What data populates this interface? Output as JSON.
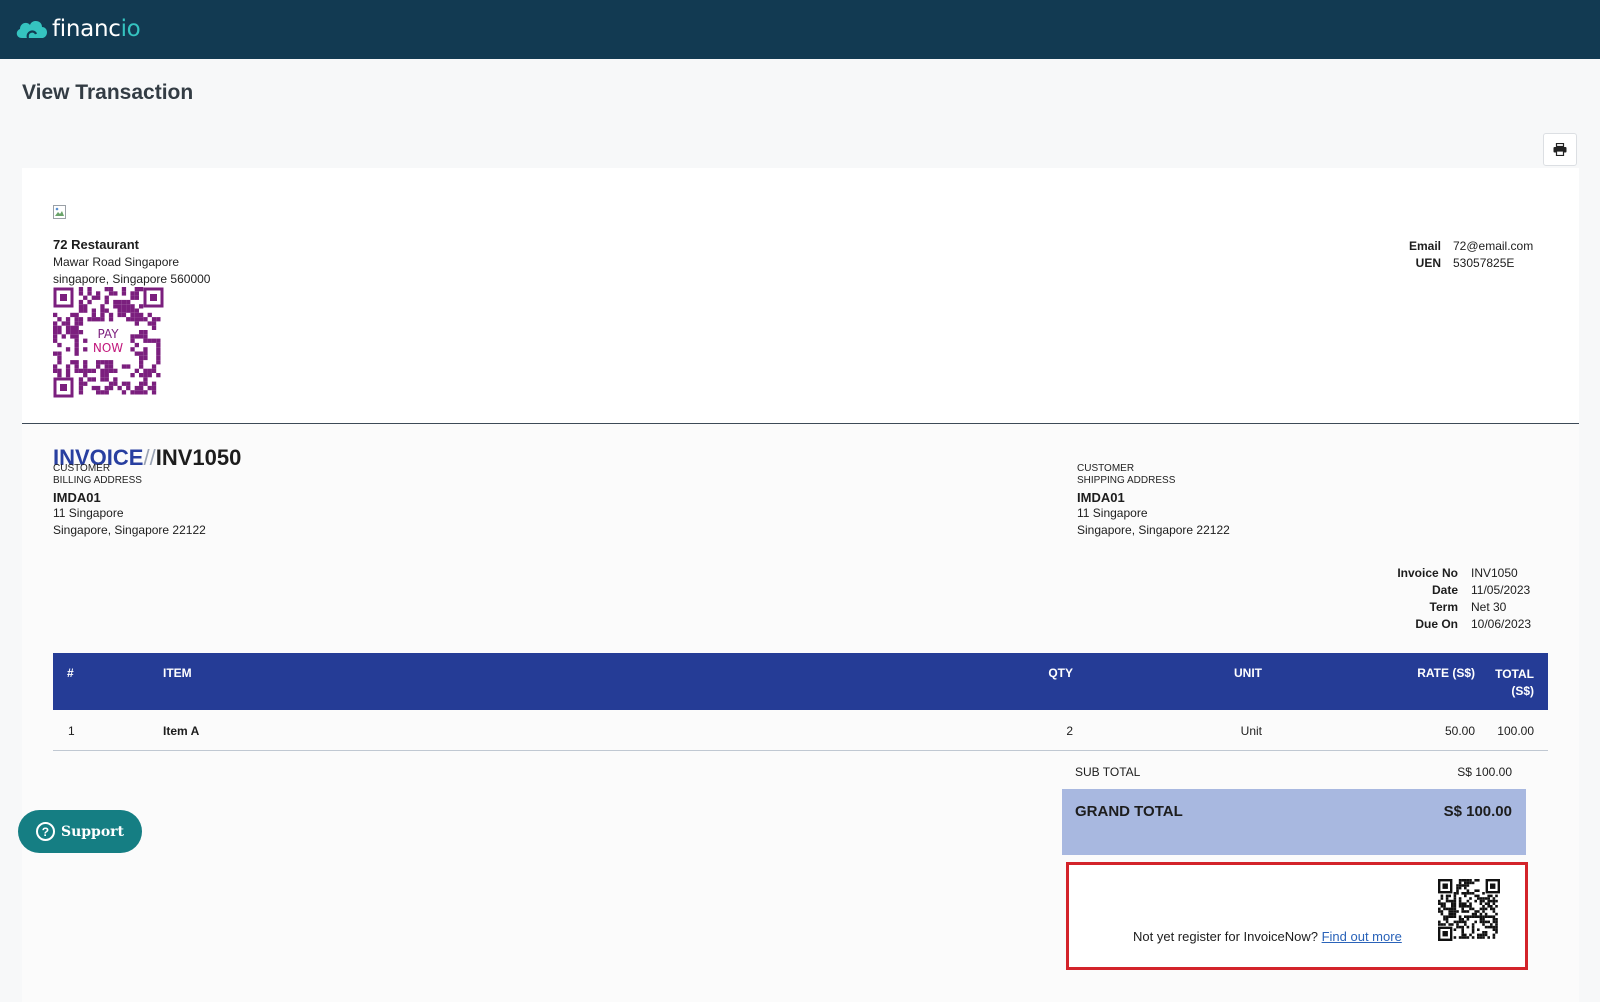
{
  "app": {
    "logo_main": "financ",
    "logo_accent": "io"
  },
  "page": {
    "title": "View Transaction"
  },
  "toolbar": {
    "print_icon": "printer-icon"
  },
  "company": {
    "name": "72 Restaurant",
    "address_line1": "Mawar Road Singapore",
    "address_line2": "singapore, Singapore 560000",
    "paynow_text": "PAY NOW",
    "contact": [
      {
        "label": "Email",
        "value": "72@email.com"
      },
      {
        "label": "UEN",
        "value": "53057825E"
      }
    ]
  },
  "invoice": {
    "prefix": "INVOICE",
    "separator": "//",
    "number": "INV1050",
    "billing": {
      "caption1": "CUSTOMER",
      "caption2": "BILLING ADDRESS",
      "code": "IMDA01",
      "line1": "11 Singapore",
      "line2": "Singapore, Singapore 22122"
    },
    "shipping": {
      "caption1": "CUSTOMER",
      "caption2": "SHIPPING ADDRESS",
      "code": "IMDA01",
      "line1": "11 Singapore",
      "line2": "Singapore, Singapore 22122"
    },
    "meta": [
      {
        "label": "Invoice No",
        "value": "INV1050"
      },
      {
        "label": "Date",
        "value": "11/05/2023"
      },
      {
        "label": "Term",
        "value": "Net 30"
      },
      {
        "label": "Due On",
        "value": "10/06/2023"
      }
    ]
  },
  "table": {
    "headers": {
      "num": "#",
      "item": "ITEM",
      "qty": "QTY",
      "unit": "UNIT",
      "rate": "RATE (S$)",
      "total_l1": "TOTAL",
      "total_l2": "(S$)"
    },
    "rows": [
      {
        "num": "1",
        "item": "Item A",
        "qty": "2",
        "unit": "Unit",
        "rate": "50.00",
        "total": "100.00"
      }
    ]
  },
  "totals": {
    "sub_label": "SUB TOTAL",
    "sub_value": "S$ 100.00",
    "grand_label": "GRAND TOTAL",
    "grand_value": "S$ 100.00"
  },
  "invoicenow": {
    "text": "Not yet register for InvoiceNow?",
    "link": "Find out more"
  },
  "support": {
    "label": "Support"
  },
  "colors": {
    "topbar": "#123a52",
    "accent": "#35c3c0",
    "table_header": "#253c96",
    "grand_total_bg": "#a8b8e0",
    "highlight_border": "#d3232a",
    "support_btn": "#157e83",
    "paynow": "#7b1f7e"
  }
}
